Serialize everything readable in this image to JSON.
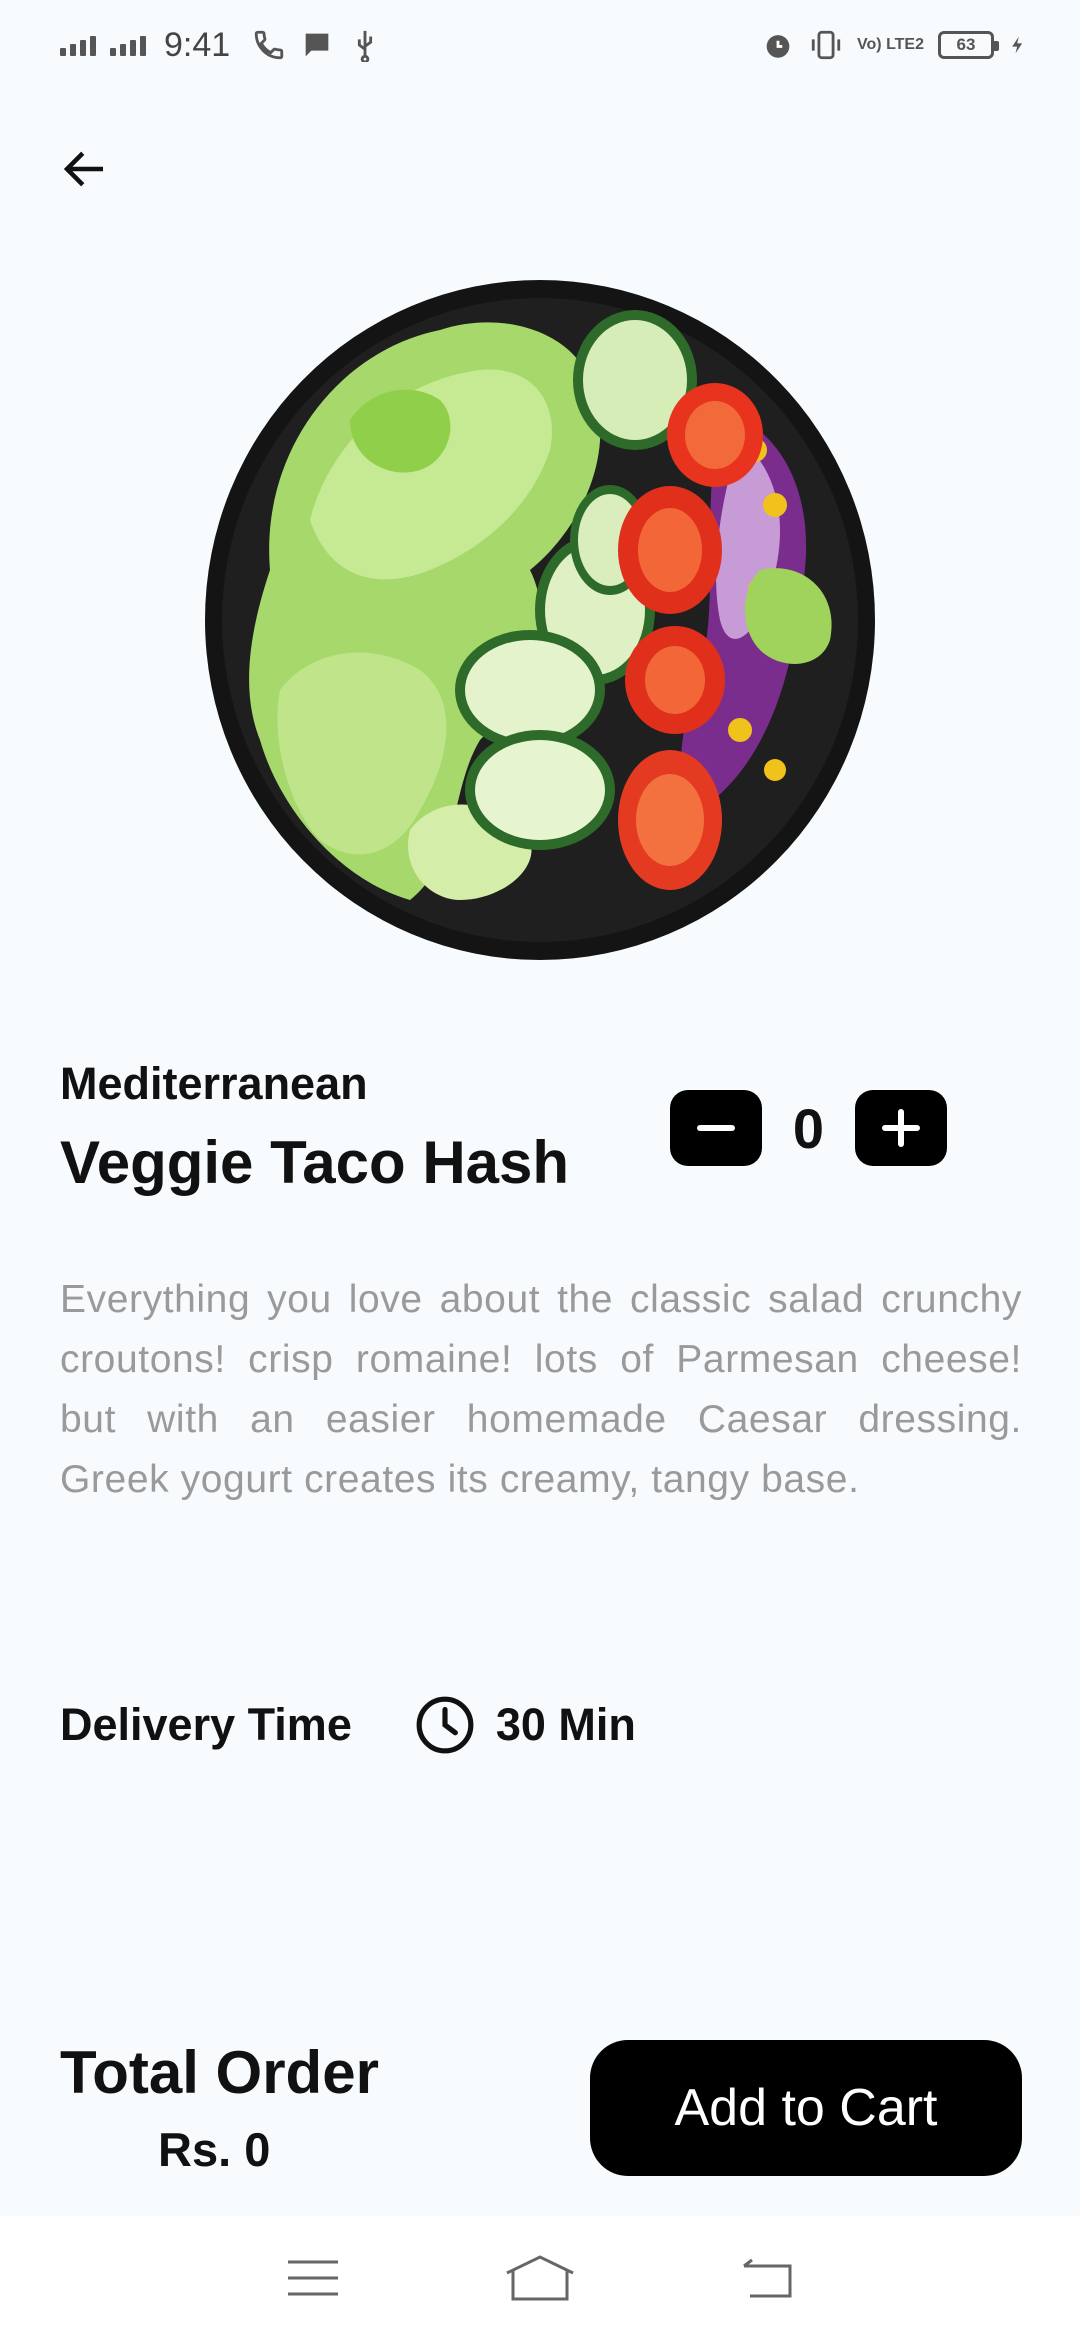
{
  "status_bar": {
    "time": "9:41",
    "battery": "63",
    "network": "Vo) LTE2",
    "icons": [
      "signal-icon",
      "phone-call-icon",
      "message-icon",
      "usb-icon",
      "alarm-icon",
      "vibrate-icon",
      "battery-icon",
      "charging-icon"
    ]
  },
  "header": {
    "back_icon": "arrow-left-icon"
  },
  "dish": {
    "image_name": "salad-bowl-image",
    "category": "Mediterranean",
    "name": "Veggie Taco Hash",
    "quantity": "0",
    "description": "Everything you love about the classic salad crunchy croutons! crisp romaine! lots of Parmesan cheese! but with an easier homemade Caesar dressing. Greek yogurt creates its creamy, tangy base."
  },
  "delivery": {
    "label": "Delivery Time",
    "icon": "clock-icon",
    "value": "30 Min"
  },
  "order": {
    "total_label": "Total Order",
    "total_amount": "Rs. 0",
    "add_to_cart_label": "Add to Cart"
  },
  "nav_bar": {
    "icons": [
      "menu-icon",
      "home-icon",
      "back-icon"
    ]
  },
  "colors": {
    "background": "#f7fbfd",
    "primary": "#000000",
    "muted_text": "#9a9a9a"
  }
}
